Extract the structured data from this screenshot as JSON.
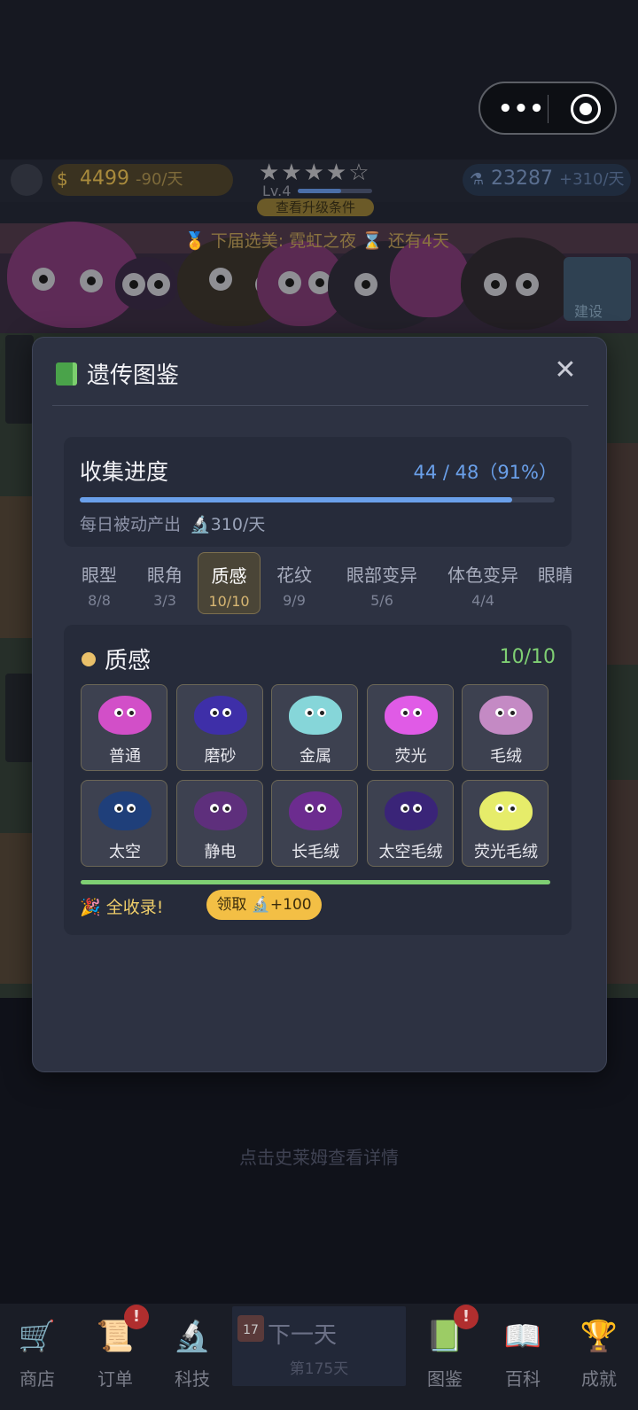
{
  "hud": {
    "coins": "4499",
    "coins_rate": "-90/天",
    "stars": "★★★★☆",
    "level": "Lv.4",
    "upgrade_hint": "查看升级条件",
    "gems": "23287",
    "gems_rate": "+310/天",
    "event": "🏅 下届选美: 霓虹之夜  ⌛ 还有4天",
    "build_label": "建设"
  },
  "scene": {
    "hint": "点击史莱姆查看详情"
  },
  "modal": {
    "title": "遗传图鉴",
    "close": "✕",
    "progress": {
      "title": "收集进度",
      "count": "44 / 48（91%）",
      "fraction": 0.91,
      "passive_label": "每日被动产出",
      "passive_value": "🔬310/天"
    },
    "tabs": [
      {
        "name": "眼型",
        "count": "8/8"
      },
      {
        "name": "眼角",
        "count": "3/3"
      },
      {
        "name": "质感",
        "count": "10/10"
      },
      {
        "name": "花纹",
        "count": "9/9"
      },
      {
        "name": "眼部变异",
        "count": "5/6"
      },
      {
        "name": "体色变异",
        "count": "4/4"
      },
      {
        "name": "眼睛",
        "count": ""
      }
    ],
    "active_tab": "质感",
    "category": {
      "title": "质感",
      "count": "10/10",
      "items": [
        {
          "label": "普通",
          "color": "#d24fc8"
        },
        {
          "label": "磨砂",
          "color": "#3e2fa8"
        },
        {
          "label": "金属",
          "color": "#86d6d9"
        },
        {
          "label": "荧光",
          "color": "#e05be6"
        },
        {
          "label": "毛绒",
          "color": "#c48ac4"
        },
        {
          "label": "太空",
          "color": "#1f3f7a"
        },
        {
          "label": "静电",
          "color": "#5e2f7c"
        },
        {
          "label": "长毛绒",
          "color": "#6c2c8f"
        },
        {
          "label": "太空毛绒",
          "color": "#3a2478"
        },
        {
          "label": "荧光毛绒",
          "color": "#e6ec6a"
        }
      ],
      "complete_text": "🎉 全收录!",
      "claim_button": "领取 🔬+100"
    }
  },
  "nav": {
    "items": [
      {
        "label": "商店",
        "icon": "cart-icon",
        "badge": ""
      },
      {
        "label": "订单",
        "icon": "scroll-icon",
        "badge": "!"
      },
      {
        "label": "科技",
        "icon": "microscope-icon",
        "badge": ""
      },
      {
        "label": "图鉴",
        "icon": "book-icon",
        "badge": "!"
      },
      {
        "label": "百科",
        "icon": "open-book-icon",
        "badge": ""
      },
      {
        "label": "成就",
        "icon": "trophy-icon",
        "badge": ""
      }
    ],
    "next_day": "下一天",
    "day_counter": "第175天",
    "calendar": "17"
  },
  "colors": {
    "accent_blue": "#6aa0ea",
    "accent_green": "#7fcf73",
    "accent_gold": "#f3bf45",
    "modal_bg": "#2d3242"
  }
}
